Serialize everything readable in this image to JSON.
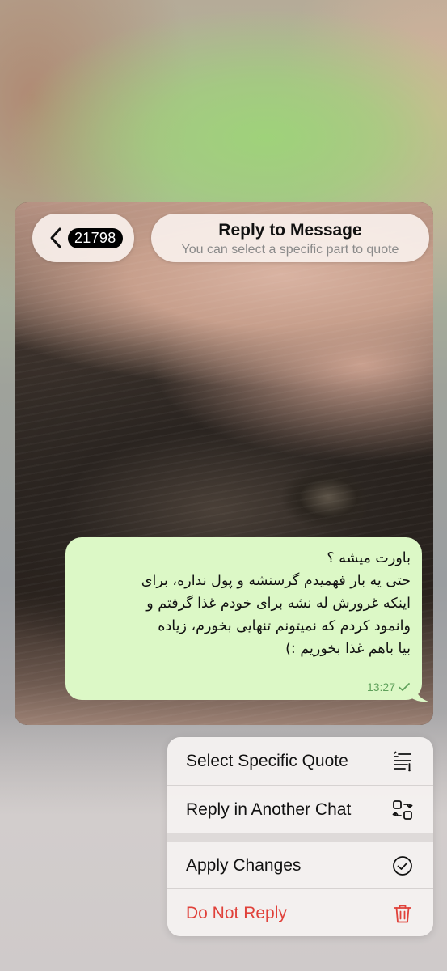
{
  "header": {
    "unread_count": "21798",
    "title": "Reply to Message",
    "subtitle": "You can select a specific part to quote"
  },
  "message": {
    "lines": [
      "باورت میشه ؟",
      "حتی یه بار فهمیدم گرسنشه و پول نداره، برای",
      "اینکه غرورش له نشه برای خودم غذا گرفتم و",
      "وانمود کردم که نمیتونم تنهایی بخورم، زیاده",
      "بیا باهم غذا بخوریم :)"
    ],
    "time": "13:27",
    "bubble_color": "#dcf8c6"
  },
  "menu": {
    "items": [
      {
        "label": "Select Specific Quote",
        "icon": "select-quote-icon"
      },
      {
        "label": "Reply in Another Chat",
        "icon": "reply-another-chat-icon"
      },
      {
        "label": "Apply Changes",
        "icon": "checkmark-circle-icon"
      },
      {
        "label": "Do Not Reply",
        "icon": "trash-icon",
        "color": "#e0413a"
      }
    ]
  }
}
